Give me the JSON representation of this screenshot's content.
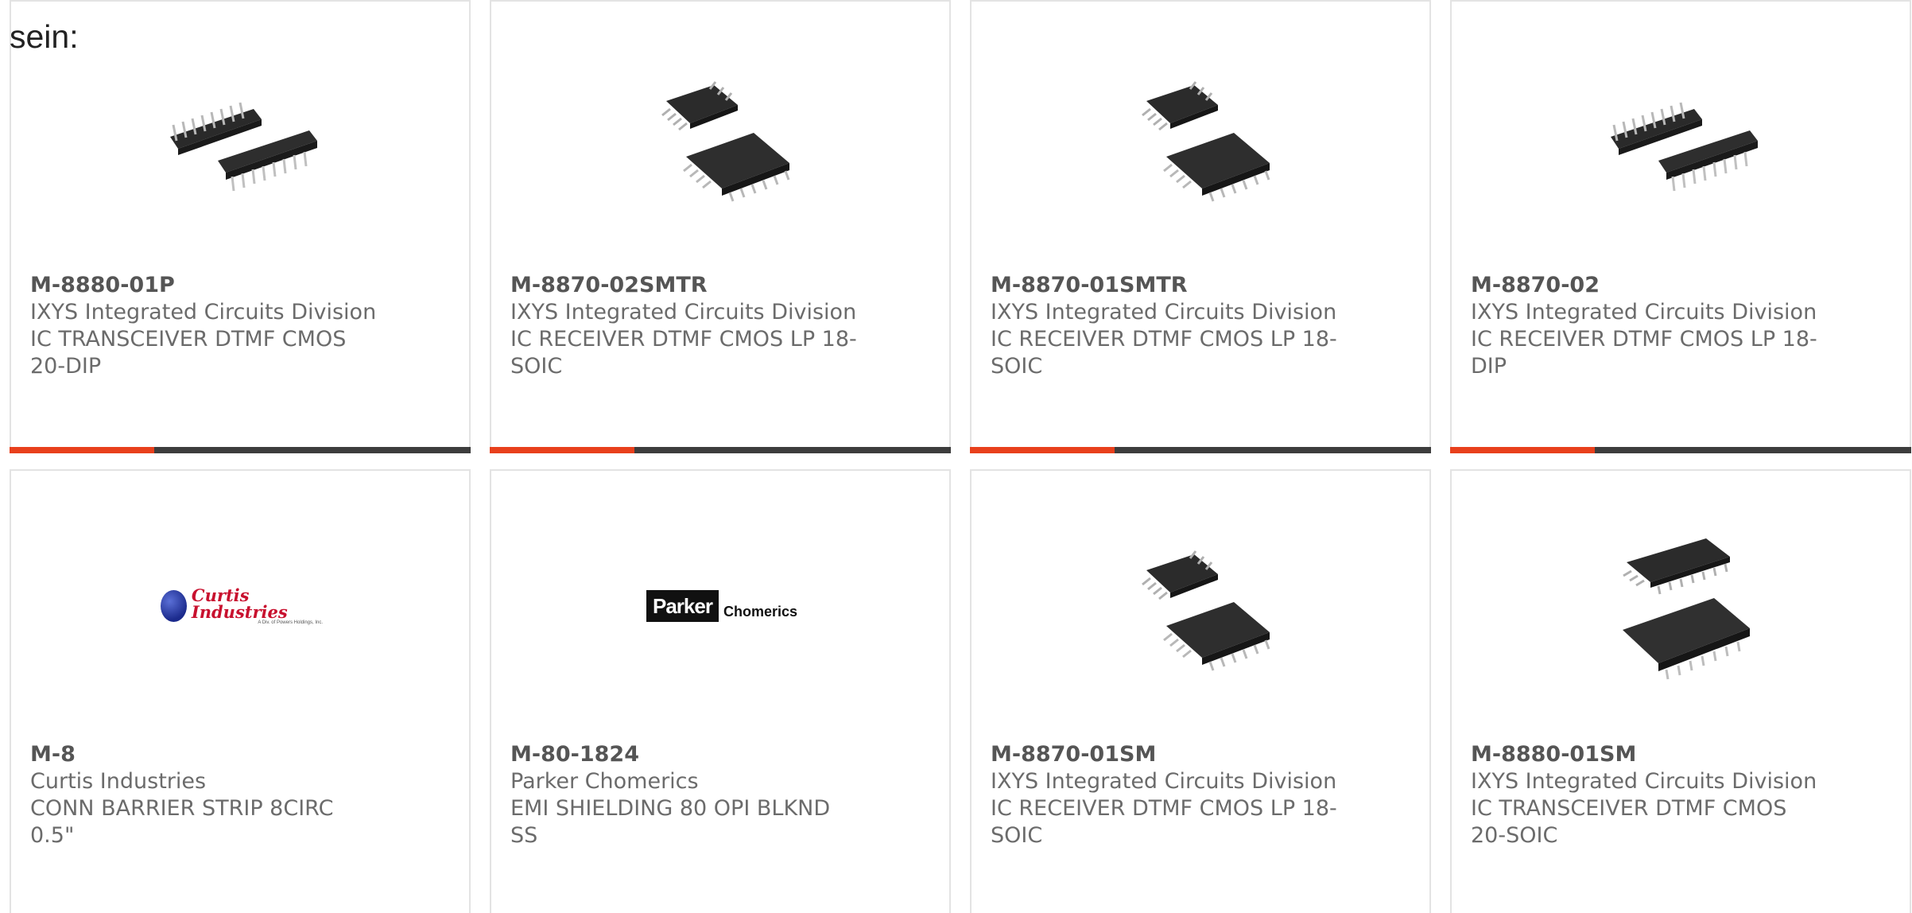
{
  "intro_text": "sein:",
  "cards": [
    {
      "part_number": "M-8880-01P",
      "manufacturer": "IXYS Integrated Circuits Division",
      "description_line1": "IC TRANSCEIVER DTMF CMOS",
      "description_line2": "20-DIP",
      "image": "dip-ic-photo"
    },
    {
      "part_number": "M-8870-02SMTR",
      "manufacturer": "IXYS Integrated Circuits Division",
      "description_line1": "IC RECEIVER DTMF CMOS LP 18-",
      "description_line2": "SOIC",
      "image": "soic-ic-photo"
    },
    {
      "part_number": "M-8870-01SMTR",
      "manufacturer": "IXYS Integrated Circuits Division",
      "description_line1": "IC RECEIVER DTMF CMOS LP 18-",
      "description_line2": "SOIC",
      "image": "soic-ic-photo"
    },
    {
      "part_number": "M-8870-02",
      "manufacturer": "IXYS Integrated Circuits Division",
      "description_line1": "IC RECEIVER DTMF CMOS LP 18-",
      "description_line2": "DIP",
      "image": "dip-ic-photo"
    },
    {
      "part_number": "M-8",
      "manufacturer": "Curtis Industries",
      "description_line1": "CONN BARRIER STRIP 8CIRC",
      "description_line2": "0.5\"",
      "image": "curtis-logo",
      "logo_text": "Curtis Industries",
      "logo_subtext": "A Div. of Powers Holdings, Inc."
    },
    {
      "part_number": "M-80-1824",
      "manufacturer": "Parker Chomerics",
      "description_line1": "EMI SHIELDING 80 OPI BLKND",
      "description_line2": "SS",
      "image": "parker-logo",
      "logo_text": "Parker",
      "logo_subtext": "Chomerics"
    },
    {
      "part_number": "M-8870-01SM",
      "manufacturer": "IXYS Integrated Circuits Division",
      "description_line1": "IC RECEIVER DTMF CMOS LP 18-",
      "description_line2": "SOIC",
      "image": "soic-ic-photo"
    },
    {
      "part_number": "M-8880-01SM",
      "manufacturer": "IXYS Integrated Circuits Division",
      "description_line1": "IC TRANSCEIVER DTMF CMOS",
      "description_line2": "20-SOIC",
      "image": "soic-wide-ic-photo"
    }
  ],
  "colors": {
    "accent": "#e8401c",
    "bar": "#3d3d3d",
    "card_border": "#e3e3e3",
    "text_muted": "#6b6b6b"
  }
}
